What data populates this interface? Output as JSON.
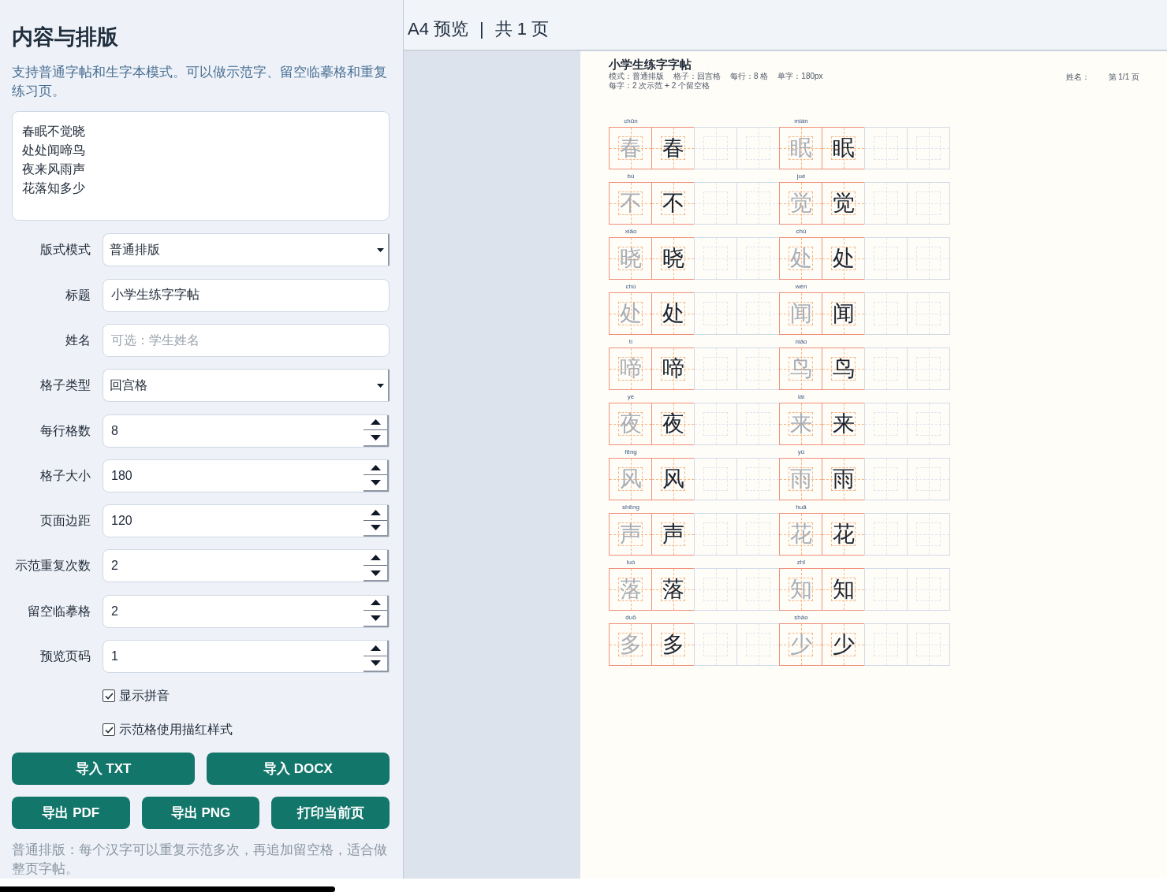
{
  "sidebar": {
    "title": "内容与排版",
    "description": "支持普通字帖和生字本模式。可以做示范字、留空临摹格和重复练习页。",
    "text_lines": [
      "春眠不觉晓",
      "处处闻啼鸟",
      "夜来风雨声",
      "花落知多少"
    ],
    "fields": [
      {
        "kind": "select",
        "label": "版式模式",
        "value": "普通排版"
      },
      {
        "kind": "text",
        "label": "标题",
        "value": "小学生练字字帖"
      },
      {
        "kind": "text",
        "label": "姓名",
        "placeholder": "可选：学生姓名"
      },
      {
        "kind": "select",
        "label": "格子类型",
        "value": "回宫格"
      },
      {
        "kind": "number",
        "label": "每行格数",
        "value": "8"
      },
      {
        "kind": "number",
        "label": "格子大小",
        "value": "180"
      },
      {
        "kind": "number",
        "label": "页面边距",
        "value": "120"
      },
      {
        "kind": "number",
        "label": "示范重复次数",
        "value": "2"
      },
      {
        "kind": "number",
        "label": "留空临摹格",
        "value": "2"
      },
      {
        "kind": "number",
        "label": "预览页码",
        "value": "1"
      }
    ],
    "checkboxes": [
      {
        "label": "显示拼音",
        "checked": true
      },
      {
        "label": "示范格使用描红样式",
        "checked": true
      }
    ],
    "button_rows": [
      [
        "导入 TXT",
        "导入 DOCX"
      ],
      [
        "导出 PDF",
        "导出 PNG",
        "打印当前页"
      ]
    ],
    "note": "普通排版：每个汉字可以重复示范多次，再追加留空格，适合做整页字帖。"
  },
  "preview": {
    "heading": "A4 预览",
    "separator": "|",
    "page_count": "共 1 页",
    "page": {
      "title": "小学生练字字帖",
      "meta_lines": [
        [
          "模式：普通排版",
          "格子：回宫格",
          "每行：8 格",
          "单字：180px"
        ],
        [
          "每字：2 次示范 + 2 个留空格"
        ]
      ],
      "name_label": "姓名：",
      "page_number": "第 1/1 页",
      "characters": [
        {
          "pinyin": "chūn",
          "cells": [
            {
              "kind": "trace",
              "text": "春"
            },
            {
              "kind": "solid",
              "text": "春"
            },
            {
              "kind": "blank"
            },
            {
              "kind": "blank"
            }
          ]
        },
        {
          "pinyin": "mián",
          "cells": [
            {
              "kind": "trace",
              "text": "眠"
            },
            {
              "kind": "solid",
              "text": "眠"
            },
            {
              "kind": "blank"
            },
            {
              "kind": "blank"
            }
          ]
        },
        {
          "pinyin": "bù",
          "cells": [
            {
              "kind": "trace",
              "text": "不"
            },
            {
              "kind": "solid",
              "text": "不"
            },
            {
              "kind": "blank"
            },
            {
              "kind": "blank"
            }
          ]
        },
        {
          "pinyin": "jué",
          "cells": [
            {
              "kind": "trace",
              "text": "觉"
            },
            {
              "kind": "solid",
              "text": "觉"
            },
            {
              "kind": "blank"
            },
            {
              "kind": "blank"
            }
          ]
        },
        {
          "pinyin": "xiǎo",
          "cells": [
            {
              "kind": "trace",
              "text": "晓"
            },
            {
              "kind": "solid",
              "text": "晓"
            },
            {
              "kind": "blank"
            },
            {
              "kind": "blank"
            }
          ]
        },
        {
          "pinyin": "chù",
          "cells": [
            {
              "kind": "trace",
              "text": "处"
            },
            {
              "kind": "solid",
              "text": "处"
            },
            {
              "kind": "blank"
            },
            {
              "kind": "blank"
            }
          ]
        },
        {
          "pinyin": "chù",
          "cells": [
            {
              "kind": "trace",
              "text": "处"
            },
            {
              "kind": "solid",
              "text": "处"
            },
            {
              "kind": "blank"
            },
            {
              "kind": "blank"
            }
          ]
        },
        {
          "pinyin": "wén",
          "cells": [
            {
              "kind": "trace",
              "text": "闻"
            },
            {
              "kind": "solid",
              "text": "闻"
            },
            {
              "kind": "blank"
            },
            {
              "kind": "blank"
            }
          ]
        },
        {
          "pinyin": "tí",
          "cells": [
            {
              "kind": "trace",
              "text": "啼"
            },
            {
              "kind": "solid",
              "text": "啼"
            },
            {
              "kind": "blank"
            },
            {
              "kind": "blank"
            }
          ]
        },
        {
          "pinyin": "niǎo",
          "cells": [
            {
              "kind": "trace",
              "text": "鸟"
            },
            {
              "kind": "solid",
              "text": "鸟"
            },
            {
              "kind": "blank"
            },
            {
              "kind": "blank"
            }
          ]
        },
        {
          "pinyin": "yè",
          "cells": [
            {
              "kind": "trace",
              "text": "夜"
            },
            {
              "kind": "solid",
              "text": "夜"
            },
            {
              "kind": "blank"
            },
            {
              "kind": "blank"
            }
          ]
        },
        {
          "pinyin": "lái",
          "cells": [
            {
              "kind": "trace",
              "text": "来"
            },
            {
              "kind": "solid",
              "text": "来"
            },
            {
              "kind": "blank"
            },
            {
              "kind": "blank"
            }
          ]
        },
        {
          "pinyin": "fēng",
          "cells": [
            {
              "kind": "trace",
              "text": "风"
            },
            {
              "kind": "solid",
              "text": "风"
            },
            {
              "kind": "blank"
            },
            {
              "kind": "blank"
            }
          ]
        },
        {
          "pinyin": "yǔ",
          "cells": [
            {
              "kind": "trace",
              "text": "雨"
            },
            {
              "kind": "solid",
              "text": "雨"
            },
            {
              "kind": "blank"
            },
            {
              "kind": "blank"
            }
          ]
        },
        {
          "pinyin": "shēng",
          "cells": [
            {
              "kind": "trace",
              "text": "声"
            },
            {
              "kind": "solid",
              "text": "声"
            },
            {
              "kind": "blank"
            },
            {
              "kind": "blank"
            }
          ]
        },
        {
          "pinyin": "huā",
          "cells": [
            {
              "kind": "trace",
              "text": "花"
            },
            {
              "kind": "solid",
              "text": "花"
            },
            {
              "kind": "blank"
            },
            {
              "kind": "blank"
            }
          ]
        },
        {
          "pinyin": "luò",
          "cells": [
            {
              "kind": "trace",
              "text": "落"
            },
            {
              "kind": "solid",
              "text": "落"
            },
            {
              "kind": "blank"
            },
            {
              "kind": "blank"
            }
          ]
        },
        {
          "pinyin": "zhī",
          "cells": [
            {
              "kind": "trace",
              "text": "知"
            },
            {
              "kind": "solid",
              "text": "知"
            },
            {
              "kind": "blank"
            },
            {
              "kind": "blank"
            }
          ]
        },
        {
          "pinyin": "duō",
          "cells": [
            {
              "kind": "trace",
              "text": "多"
            },
            {
              "kind": "solid",
              "text": "多"
            },
            {
              "kind": "blank"
            },
            {
              "kind": "blank"
            }
          ]
        },
        {
          "pinyin": "shǎo",
          "cells": [
            {
              "kind": "trace",
              "text": "少"
            },
            {
              "kind": "solid",
              "text": "少"
            },
            {
              "kind": "blank"
            },
            {
              "kind": "blank"
            }
          ]
        }
      ]
    }
  }
}
